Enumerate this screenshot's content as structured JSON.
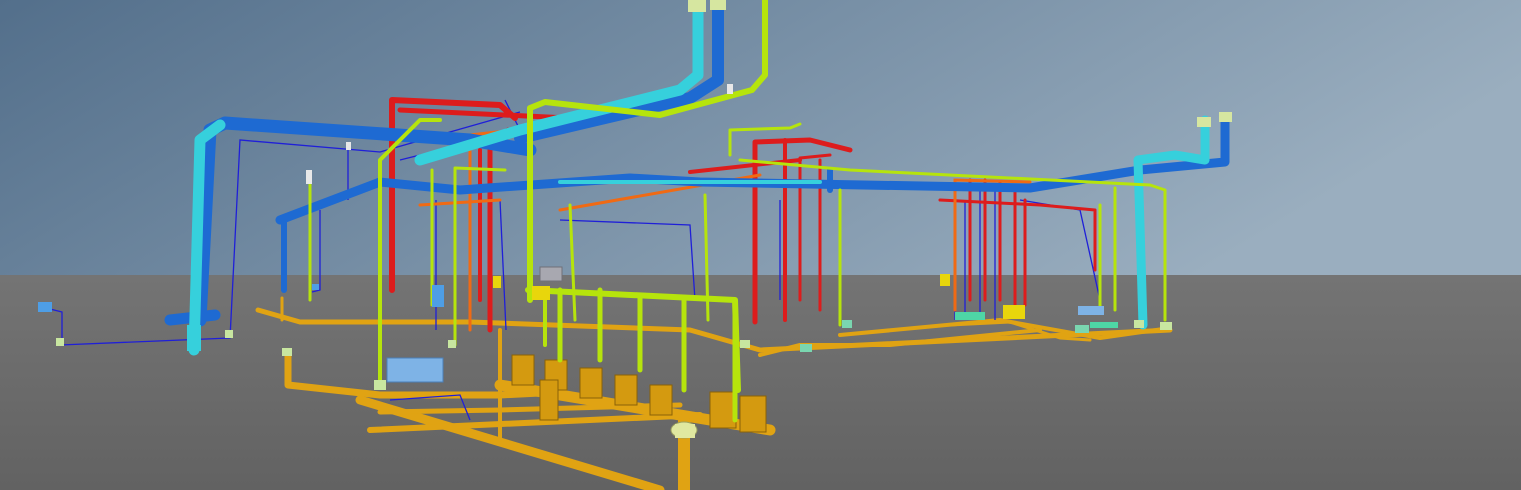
{
  "viewport": {
    "colors": {
      "sky_top": "#5c7894",
      "sky_horizon": "#8fa4b8",
      "ground": "#6e6e6e",
      "ground_near": "#666666"
    }
  },
  "systems": [
    {
      "name": "cold-water-main",
      "color": "#1f6fd6"
    },
    {
      "name": "cold-water-riser",
      "color": "#35d2de"
    },
    {
      "name": "hot-water",
      "color": "#e01a1a"
    },
    {
      "name": "hot-water-return",
      "color": "#f06a12"
    },
    {
      "name": "gas-vent",
      "color": "#b8e80c"
    },
    {
      "name": "drain-waste",
      "color": "#e8a512"
    },
    {
      "name": "control-wiring",
      "color": "#1a1ae0"
    }
  ],
  "equipment": [
    {
      "name": "water-heater-block",
      "color": "#7eb3e6"
    },
    {
      "name": "expansion-tank",
      "color": "#4e9ee6"
    },
    {
      "name": "pump-unit",
      "color": "#e8d60c"
    }
  ]
}
